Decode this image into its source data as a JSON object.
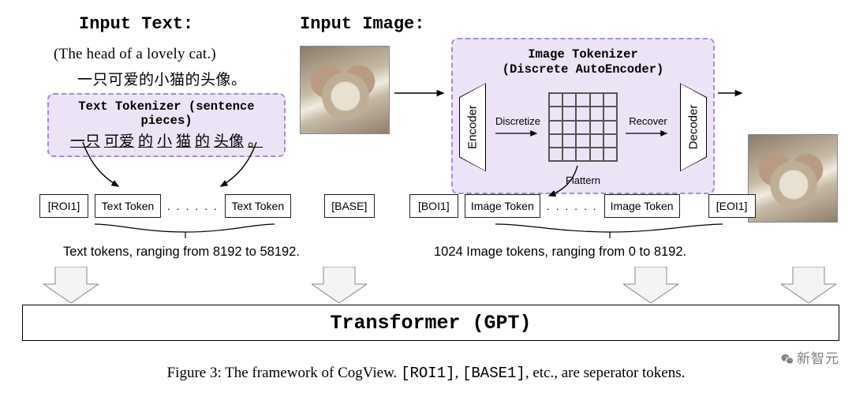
{
  "headers": {
    "input_text": "Input Text:",
    "input_image": "Input Image:"
  },
  "text_sample": {
    "english": "(The head of a lovely cat.)",
    "chinese": "一只可爱的小猫的头像。"
  },
  "text_tokenizer": {
    "title": "Text Tokenizer (sentence pieces)",
    "segments": [
      "一只",
      "可爱",
      "的",
      "小",
      "猫",
      "的",
      "头像",
      "。"
    ]
  },
  "image_tokenizer": {
    "title_line1": "Image Tokenizer",
    "title_line2": "(Discrete AutoEncoder)",
    "encoder_label": "Encoder",
    "decoder_label": "Decoder",
    "discretize_label": "Discretize",
    "recover_label": "Recover",
    "flattern_label": "Flattern"
  },
  "tokens": {
    "roi1": "[ROI1]",
    "text_token": "Text Token",
    "dots": ". . . . . .",
    "base": "[BASE]",
    "boi1": "[BOI1]",
    "image_token": "Image Token",
    "eoi1": "[EOI1]"
  },
  "ranges": {
    "text_tokens": "Text tokens, ranging from 8192 to 58192.",
    "image_tokens": "1024 Image tokens, ranging from 0 to 8192."
  },
  "transformer": {
    "label": "Transformer (GPT)"
  },
  "caption": {
    "prefix": "Figure 3: The framework of CogView. ",
    "mono1": "[ROI1]",
    "between": ", ",
    "mono2": "[BASE1]",
    "suffix": ", etc., are seperator tokens."
  },
  "watermark": "新智元",
  "chart_data": {
    "type": "diagram",
    "description": "Architecture diagram of CogView: text and image inputs are tokenized (text tokens 8192–58192; 1024 image tokens 0–8192) and fed into a Transformer (GPT) with separator tokens [ROI1], [BASE], [BOI1], [EOI1]."
  }
}
